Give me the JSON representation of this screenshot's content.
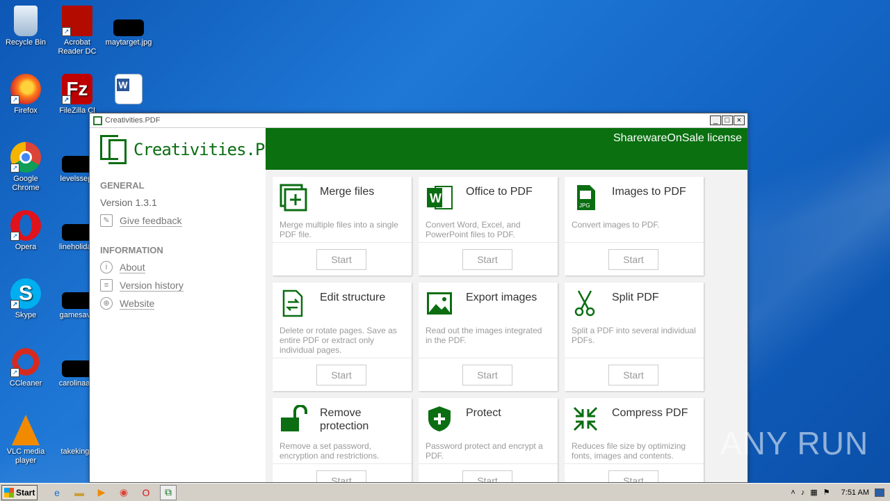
{
  "desktop": {
    "icons": [
      {
        "label": "Recycle Bin",
        "icon": "recycle-bin-icon"
      },
      {
        "label": "Acrobat Reader DC",
        "icon": "acrobat-icon"
      },
      {
        "label": "maytarget.jpg",
        "icon": "image-file-icon"
      },
      {
        "label": "Firefox",
        "icon": "firefox-icon"
      },
      {
        "label": "FileZilla Cl",
        "icon": "filezilla-icon"
      },
      {
        "label": "",
        "icon": "word-doc-icon"
      },
      {
        "label": "Google Chrome",
        "icon": "chrome-icon"
      },
      {
        "label": "levelssep.",
        "icon": "file-icon"
      },
      {
        "label": "Opera",
        "icon": "opera-icon"
      },
      {
        "label": "lineholiday",
        "icon": "file-icon"
      },
      {
        "label": "Skype",
        "icon": "skype-icon"
      },
      {
        "label": "gamesava",
        "icon": "file-icon"
      },
      {
        "label": "CCleaner",
        "icon": "ccleaner-icon"
      },
      {
        "label": "carolinaasi",
        "icon": "file-icon"
      },
      {
        "label": "VLC media player",
        "icon": "vlc-icon"
      },
      {
        "label": "takekingd",
        "icon": "file-icon"
      }
    ]
  },
  "window": {
    "title": "Creativities.PDF",
    "min": "_",
    "max": "□",
    "close": "×"
  },
  "app": {
    "logo": "Creativities.PDF",
    "license": "SharewareOnSale license",
    "general": {
      "heading": "GENERAL",
      "version": "Version 1.3.1",
      "feedback": "Give feedback"
    },
    "information": {
      "heading": "INFORMATION",
      "about": "About",
      "version_history": "Version history",
      "website": "Website"
    },
    "start_label": "Start",
    "cards": [
      {
        "title": "Merge files",
        "desc": "Merge multiple files into a single PDF file.",
        "icon": "merge-icon"
      },
      {
        "title": "Office to PDF",
        "desc": "Convert Word, Excel, and PowerPoint files to PDF.",
        "icon": "word-icon"
      },
      {
        "title": "Images to PDF",
        "desc": "Convert images to PDF.",
        "icon": "jpg-icon"
      },
      {
        "title": "Edit structure",
        "desc": "Delete or rotate pages. Save as entire PDF or extract only individual pages.",
        "icon": "edit-structure-icon"
      },
      {
        "title": "Export images",
        "desc": "Read out the images integrated in the PDF.",
        "icon": "image-icon"
      },
      {
        "title": "Split PDF",
        "desc": "Split a PDF into several individual PDFs.",
        "icon": "scissors-icon"
      },
      {
        "title": "Remove protection",
        "desc": "Remove a set password, encryption and restrictions.",
        "icon": "unlock-icon"
      },
      {
        "title": "Protect",
        "desc": "Password protect and encrypt a PDF.",
        "icon": "shield-icon"
      },
      {
        "title": "Compress PDF",
        "desc": "Reduces file size by optimizing fonts, images and contents.",
        "icon": "compress-icon"
      }
    ]
  },
  "taskbar": {
    "start": "Start",
    "clock": "7:51 AM"
  },
  "watermark": "ANY RUN"
}
